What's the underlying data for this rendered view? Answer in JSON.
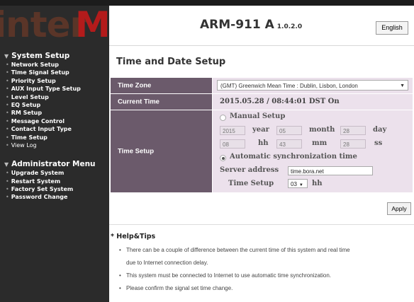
{
  "brand": {
    "logo_prefix": "inter",
    "logo_suffix": "M"
  },
  "header": {
    "model": "ARM-911 A",
    "version": "1.0.2.0",
    "language": "English"
  },
  "sidebar": {
    "system_setup": {
      "title": "System Setup",
      "items": [
        {
          "label": "Network Setup"
        },
        {
          "label": "Time Signal Setup"
        },
        {
          "label": "Priority Setup"
        },
        {
          "label": "AUX Input Type Setup"
        },
        {
          "label": "Level Setup"
        },
        {
          "label": "EQ Setup"
        },
        {
          "label": "RM Setup"
        },
        {
          "label": "Message Control"
        },
        {
          "label": "Contact Input Type"
        },
        {
          "label": "Time Setup"
        },
        {
          "label": "View Log"
        }
      ]
    },
    "admin_menu": {
      "title": "Administrator Menu",
      "items": [
        {
          "label": "Upgrade System"
        },
        {
          "label": "Restart System"
        },
        {
          "label": "Factory Set System"
        },
        {
          "label": "Password Change"
        }
      ]
    }
  },
  "page": {
    "title": "Time and Date Setup",
    "time_zone": {
      "label": "Time Zone",
      "value": "(GMT) Greenwich Mean Time : Dublin, Lisbon, London"
    },
    "current_time": {
      "label": "Current Time",
      "value": "2015.05.28 / 08:44:01 DST On"
    },
    "time_setup": {
      "label": "Time Setup",
      "manual": {
        "label": "Manual Setup",
        "selected": false,
        "year": "2015",
        "year_unit": "year",
        "month": "05",
        "month_unit": "month",
        "day": "28",
        "day_unit": "day",
        "hour": "08",
        "hour_unit": "hh",
        "minute": "43",
        "minute_unit": "mm",
        "second": "28",
        "second_unit": "ss"
      },
      "auto": {
        "label": "Automatic synchronization time",
        "selected": true,
        "server_label": "Server address",
        "server_value": "time.bora.net",
        "time_label": "Time Setup",
        "time_value": "03",
        "time_unit": "hh"
      }
    },
    "apply_label": "Apply",
    "help": {
      "title": "* Help&Tips",
      "tips": [
        "There can be a couple of difference between the current time of this system and real time",
        "due to Internet connection delay.",
        "This system must be connected to Internet to use automatic time synchronization.",
        "Please confirm the signal set time change."
      ]
    }
  }
}
